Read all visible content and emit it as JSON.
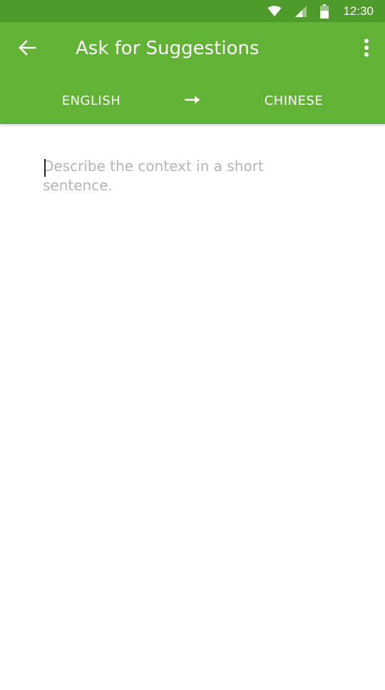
{
  "status_bar": {
    "time": "12:30",
    "icons": [
      "wifi-icon",
      "cellular-signal-icon",
      "battery-icon"
    ]
  },
  "app_bar": {
    "title": "Ask for Suggestions",
    "back_icon": "arrow-back-icon",
    "menu_icon": "more-vertical-icon"
  },
  "languages": {
    "source": "ENGLISH",
    "target": "CHINESE",
    "direction_icon": "arrow-right-icon"
  },
  "context_input": {
    "value": "",
    "placeholder": "Describe the context in a short sentence."
  },
  "colors": {
    "status_bar": "#4e9a2a",
    "app_bar": "#62b236",
    "text_on_primary": "#ffffff",
    "placeholder": "#b5b5b5"
  }
}
